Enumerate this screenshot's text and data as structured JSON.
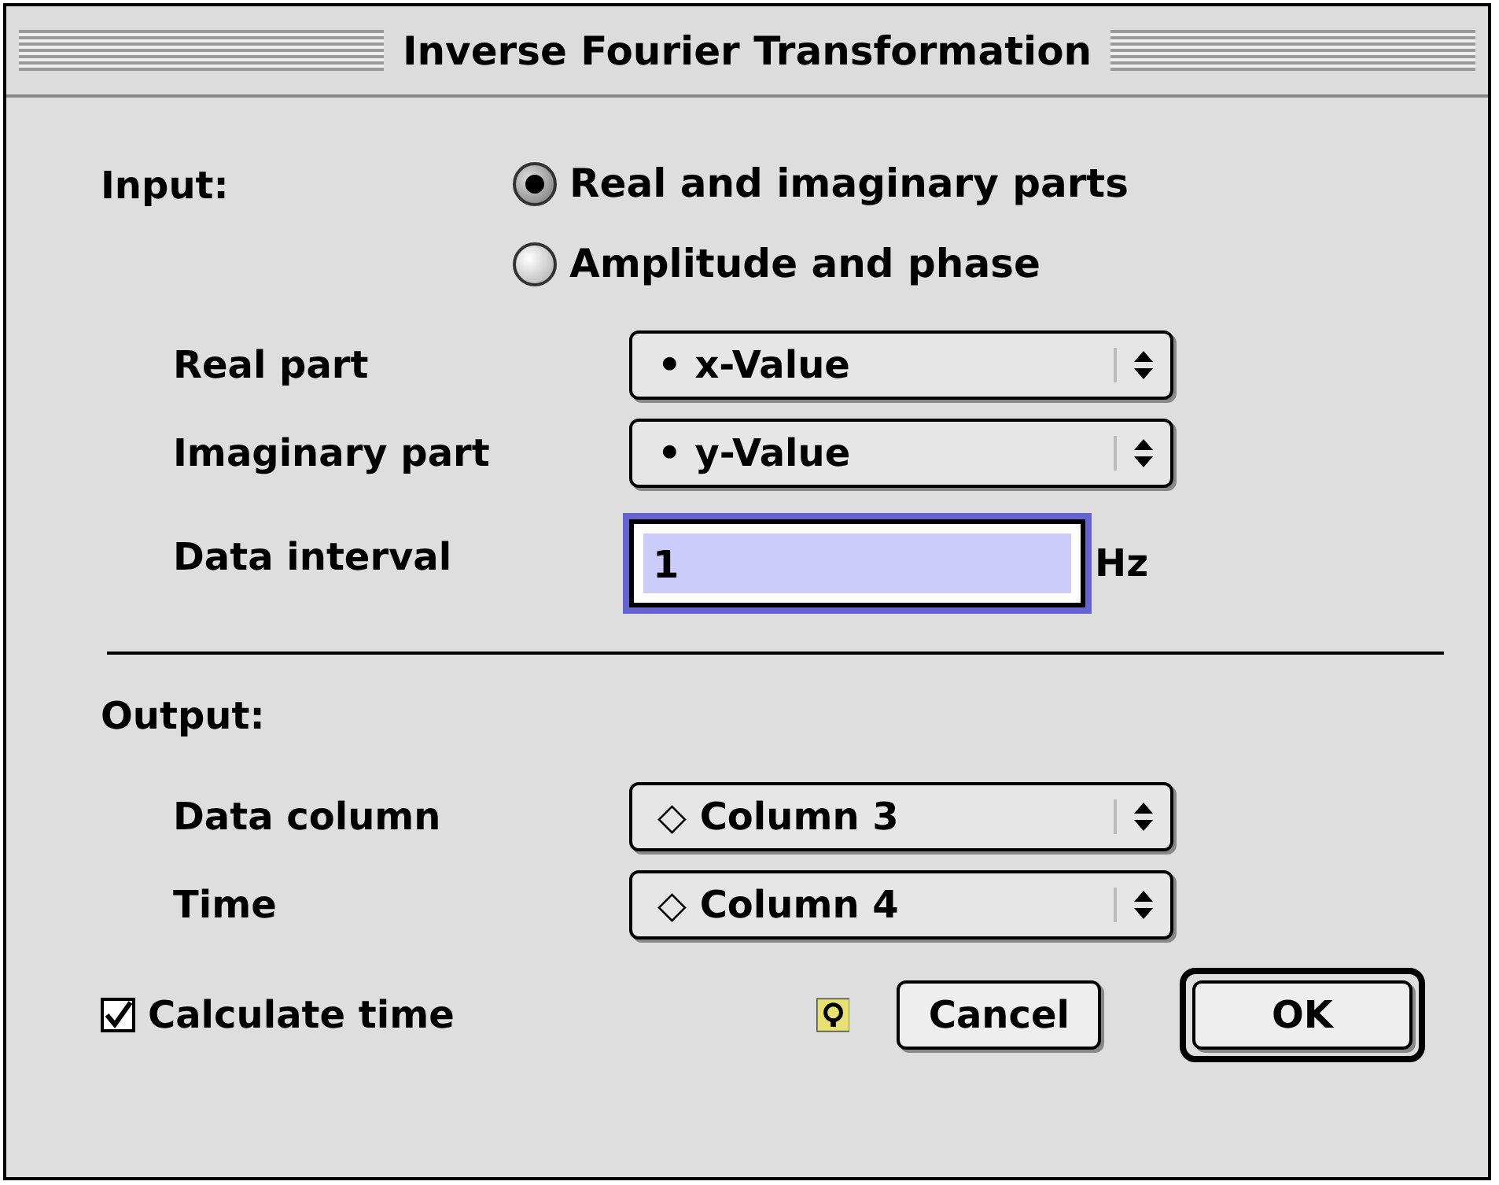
{
  "window": {
    "title": "Inverse Fourier Transformation"
  },
  "input": {
    "label": "Input:",
    "options": [
      {
        "label": "Real and imaginary parts",
        "selected": true
      },
      {
        "label": "Amplitude and phase",
        "selected": false
      }
    ],
    "rows": [
      {
        "kind": "popup",
        "label": "Real part",
        "value": "• x-Value"
      },
      {
        "kind": "popup",
        "label": "Imaginary part",
        "value": "• y-Value"
      },
      {
        "kind": "field",
        "label": "Data interval",
        "value": "1",
        "unit": "Hz",
        "focused": true
      }
    ]
  },
  "output": {
    "label": "Output:",
    "rows": [
      {
        "kind": "popup",
        "label": "Data column",
        "value": "◇ Column 3"
      },
      {
        "kind": "popup",
        "label": "Time",
        "value": "◇ Column 4"
      }
    ]
  },
  "calculate_time": {
    "label": "Calculate time",
    "checked": true
  },
  "buttons": [
    {
      "label": "Cancel",
      "default": false
    },
    {
      "label": "OK",
      "default": true
    }
  ]
}
